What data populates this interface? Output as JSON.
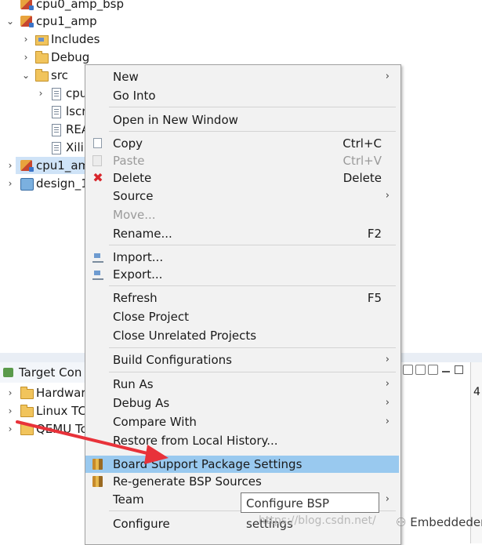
{
  "explorer": {
    "items": [
      {
        "label": "cpu0_amp_bsp"
      },
      {
        "label": "cpu1_amp"
      },
      {
        "label": "Includes"
      },
      {
        "label": "Debug"
      },
      {
        "label": "src"
      },
      {
        "label": "cpu"
      },
      {
        "label": "lscr"
      },
      {
        "label": "REA"
      },
      {
        "label": "Xili"
      },
      {
        "label": "cpu1_am"
      },
      {
        "label": "design_1"
      }
    ]
  },
  "target_panel": {
    "title": "Target Con",
    "items": [
      {
        "label": "Hardwar"
      },
      {
        "label": "Linux TC"
      },
      {
        "label": "QEMU Tc"
      }
    ],
    "right_digit": "4"
  },
  "context_menu": {
    "items": {
      "new": "New",
      "go_into": "Go Into",
      "open_new_window": "Open in New Window",
      "copy": "Copy",
      "copy_key": "Ctrl+C",
      "paste": "Paste",
      "paste_key": "Ctrl+V",
      "delete": "Delete",
      "delete_key": "Delete",
      "source": "Source",
      "move": "Move...",
      "rename": "Rename...",
      "rename_key": "F2",
      "import": "Import...",
      "export": "Export...",
      "refresh": "Refresh",
      "refresh_key": "F5",
      "close_project": "Close Project",
      "close_unrelated": "Close Unrelated Projects",
      "build_configs": "Build Configurations",
      "run_as": "Run As",
      "debug_as": "Debug As",
      "compare_with": "Compare With",
      "restore_history": "Restore from Local History...",
      "bsp_settings": "Board Support Package Settings",
      "regen_bsp": "Re-generate BSP Sources",
      "team": "Team",
      "configure": "Configure"
    }
  },
  "tooltip": "Configure BSP settings",
  "watermark": {
    "url": "https://blog.csdn.net/",
    "brand": "Embeddeder"
  },
  "colors": {
    "highlight": "#99c9ef",
    "arrow": "#e8323a",
    "selection": "#cfe3f7"
  }
}
